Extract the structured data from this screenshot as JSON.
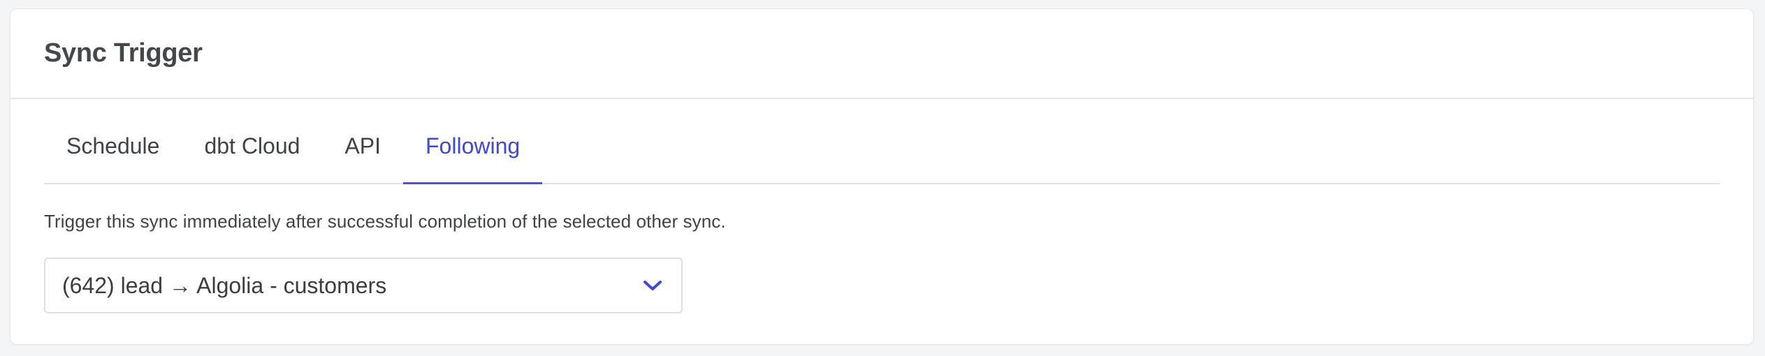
{
  "card": {
    "title": "Sync Trigger"
  },
  "tabs": [
    {
      "label": "Schedule",
      "active": false
    },
    {
      "label": "dbt Cloud",
      "active": false
    },
    {
      "label": "API",
      "active": false
    },
    {
      "label": "Following",
      "active": true
    }
  ],
  "following": {
    "description": "Trigger this sync immediately after successful completion of the selected other sync.",
    "selected_sync": "(642) lead → Algolia - customers",
    "chevron_icon": "chevron-down-icon"
  },
  "colors": {
    "accent": "#4048d6",
    "text": "#3f4348",
    "border": "#dcdfe3"
  }
}
